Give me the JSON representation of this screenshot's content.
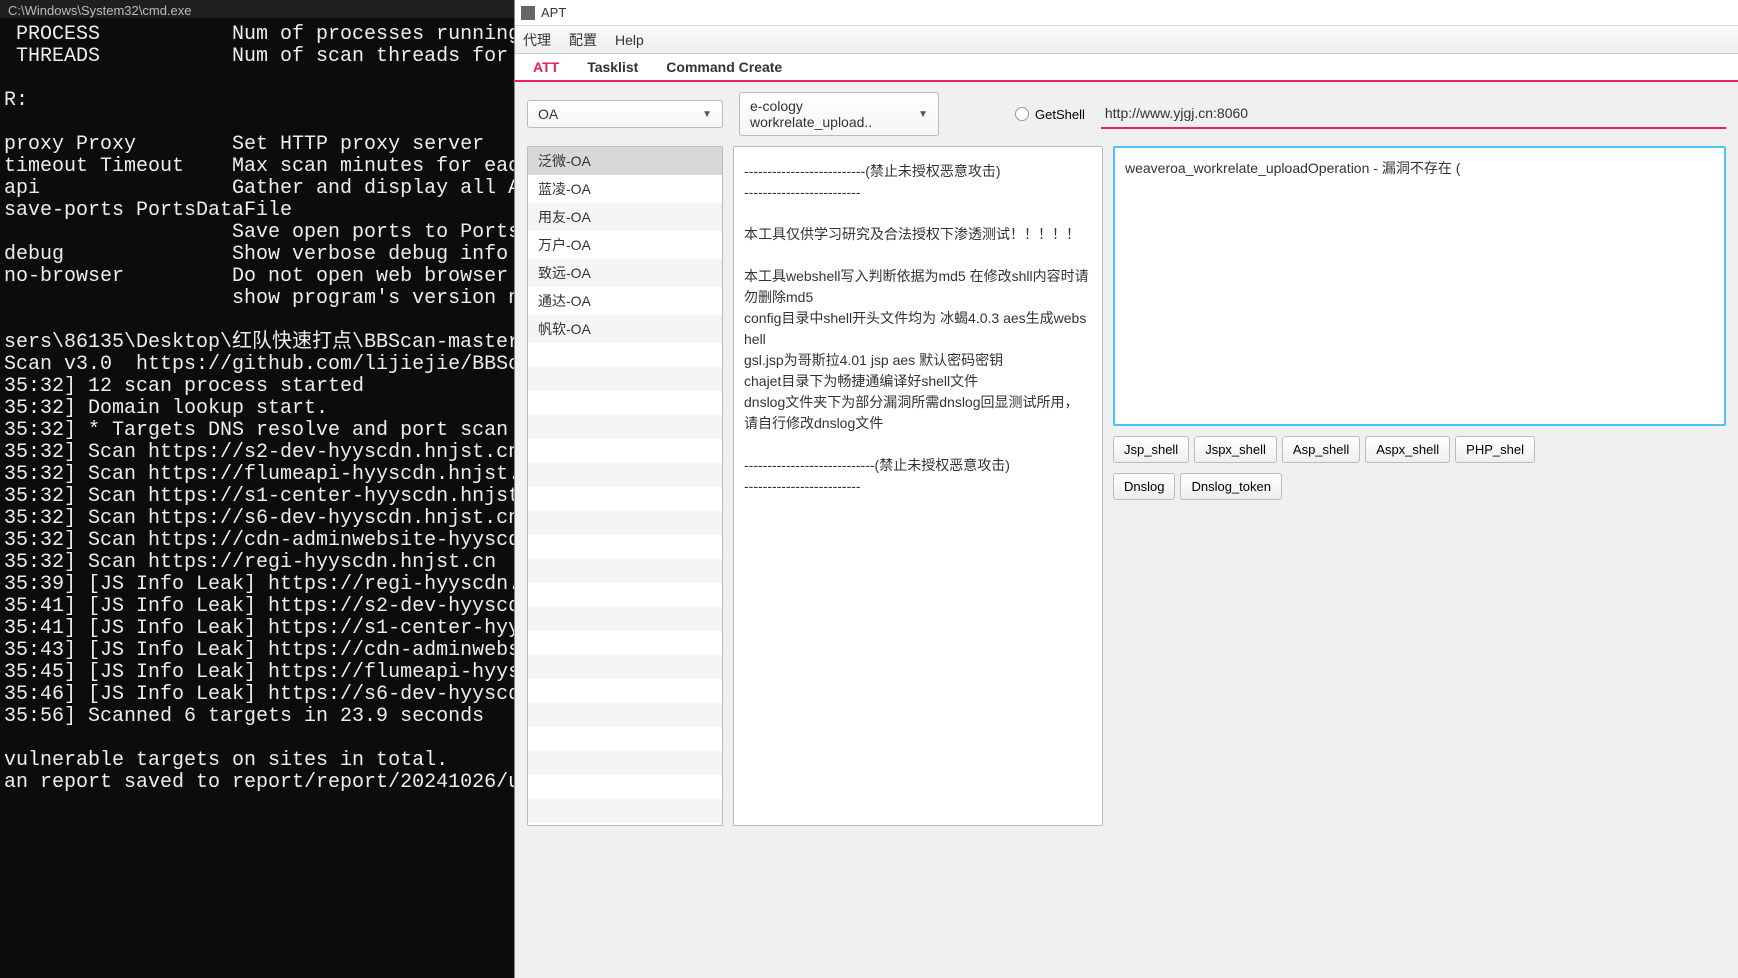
{
  "terminal": {
    "title": "C:\\Windows\\System32\\cmd.exe",
    "body": " PROCESS           Num of processes running co\n THREADS           Num of scan threads for each\n\nR:\n\nproxy Proxy        Set HTTP proxy server\ntimeout Timeout    Max scan minutes for each ta\napi                Gather and display all API i\nsave-ports PortsDataFile\n                   Save open ports to PortsData\ndebug              Show verbose debug info\nno-browser         Do not open web browser to v\n                   show program's version numbe\n\nsers\\86135\\Desktop\\红队快速打点\\BBScan-master>py\nScan v3.0  https://github.com/lijiejie/BBScan *\n35:32] 12 scan process started\n35:32] Domain lookup start.\n35:32] * Targets DNS resolve and port scan all d\n35:32] Scan https://s2-dev-hyyscdn.hnjst.cn\n35:32] Scan https://flumeapi-hyyscdn.hnjst.cn\n35:32] Scan https://s1-center-hyyscdn.hnjst.cn\n35:32] Scan https://s6-dev-hyyscdn.hnjst.cn\n35:32] Scan https://cdn-adminwebsite-hyyscdn.hn\n35:32] Scan https://regi-hyyscdn.hnjst.cn\n35:39] [JS Info Leak] https://regi-hyyscdn.hnjst\n35:41] [JS Info Leak] https://s2-dev-hyyscdn.hn\n35:41] [JS Info Leak] https://s1-center-hyyscdn.\n35:43] [JS Info Leak] https://cdn-adminwebsite-h\n35:45] [JS Info Leak] https://flumeapi-hyyscdn.h\n35:46] [JS Info Leak] https://s6-dev-hyyscdn.hn\n35:56] Scanned 6 targets in 23.9 seconds\n\nvulnerable targets on sites in total.\nan report saved to report/report/20241026/urls_"
  },
  "apt": {
    "title": "APT",
    "menu": [
      "代理",
      "配置",
      "Help"
    ],
    "tabs": [
      "ATT",
      "Tasklist",
      "Command Create"
    ],
    "dropdown1": "OA",
    "dropdown2": "e-cology workrelate_upload..",
    "getshell": "GetShell",
    "url": "http://www.yjgj.cn:8060",
    "list": [
      "泛微-OA",
      "蓝凌-OA",
      "用友-OA",
      "万户-OA",
      "致远-OA",
      "通达-OA",
      "帆软-OA"
    ],
    "info": "--------------------------(禁止未授权恶意攻击)\n-------------------------\n\n本工具仅供学习研究及合法授权下渗透测试！！！！！\n\n本工具webshell写入判断依据为md5 在修改shll内容时请勿删除md5\nconfig目录中shell开头文件均为 冰蝎4.0.3 aes生成webshell\ngsl.jsp为哥斯拉4.01 jsp aes 默认密码密钥\nchajet目录下为畅捷通编译好shell文件\ndnslog文件夹下为部分漏洞所需dnslog回显测试所用，请自行修改dnslog文件\n\n----------------------------(禁止未授权恶意攻击)\n-------------------------",
    "result": "weaveroa_workrelate_uploadOperation - 漏洞不存在 (",
    "shells": [
      "Jsp_shell",
      "Jspx_shell",
      "Asp_shell",
      "Aspx_shell",
      "PHP_shel"
    ],
    "dnslog": [
      "Dnslog",
      "Dnslog_token"
    ]
  }
}
